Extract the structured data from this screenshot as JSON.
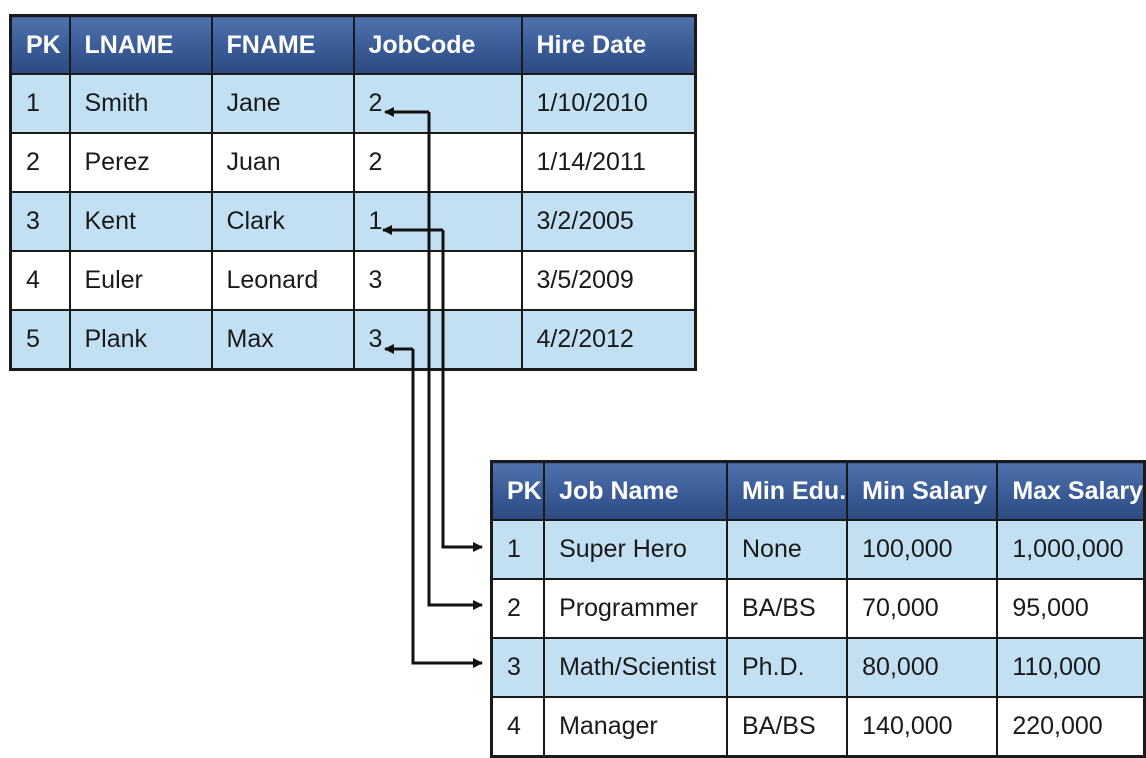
{
  "employees": {
    "headers": [
      "PK",
      "LNAME",
      "FNAME",
      "JobCode",
      "Hire Date"
    ],
    "rows": [
      [
        "1",
        "Smith",
        "Jane",
        "2",
        "1/10/2010"
      ],
      [
        "2",
        "Perez",
        "Juan",
        "2",
        "1/14/2011"
      ],
      [
        "3",
        "Kent",
        "Clark",
        "1",
        "3/2/2005"
      ],
      [
        "4",
        "Euler",
        "Leonard",
        "3",
        "3/5/2009"
      ],
      [
        "5",
        "Plank",
        "Max",
        "3",
        "4/2/2012"
      ]
    ]
  },
  "jobs": {
    "headers": [
      "PK",
      "Job Name",
      "Min Edu.",
      "Min Salary",
      "Max Salary"
    ],
    "rows": [
      [
        "1",
        "Super Hero",
        "None",
        "100,000",
        "1,000,000"
      ],
      [
        "2",
        "Programmer",
        "BA/BS",
        "70,000",
        "95,000"
      ],
      [
        "3",
        "Math/Scientist",
        "Ph.D.",
        "80,000",
        "110,000"
      ],
      [
        "4",
        "Manager",
        "BA/BS",
        "140,000",
        "220,000"
      ]
    ]
  },
  "colors": {
    "header_top": "#4f72ad",
    "header_bottom": "#2c4a80",
    "row_highlight": "#c3e0f3",
    "row_plain": "#ffffff",
    "border": "#1a1a1a"
  }
}
